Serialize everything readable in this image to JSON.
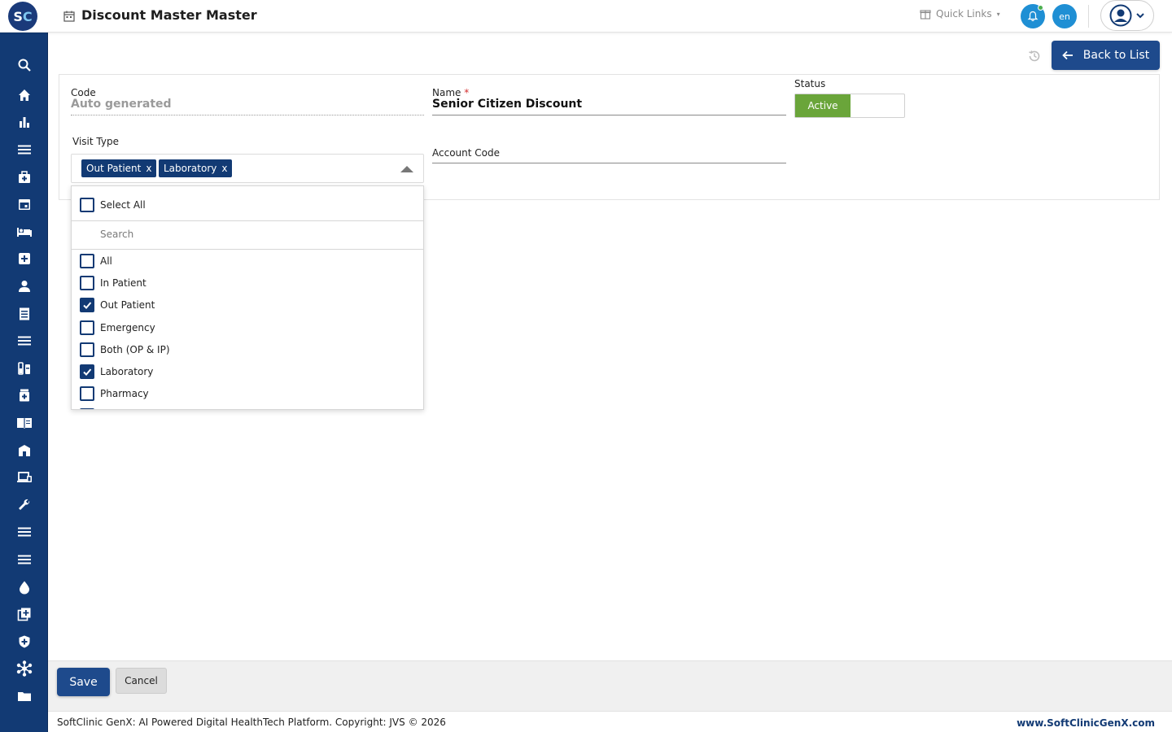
{
  "header": {
    "page_title": "Discount Master Master",
    "quick_links": "Quick Links",
    "language": "en"
  },
  "sidebar": {
    "icons": [
      "search-icon",
      "home-icon",
      "bar-chart-icon",
      "menu-icon",
      "medical-bag-icon",
      "calendar-icon",
      "bed-icon",
      "medical-cross-icon",
      "person-icon",
      "receipt-icon",
      "list-icon",
      "lab-icon",
      "medicine-icon",
      "book-icon",
      "building-icon",
      "devices-icon",
      "wrench-icon",
      "list-icon",
      "list-icon",
      "drop-icon",
      "add-document-icon",
      "shield-icon",
      "hub-icon",
      "folder-icon"
    ]
  },
  "toolbar": {
    "back_label": "Back to List"
  },
  "form": {
    "code_label": "Code",
    "code_value": "Auto generated",
    "name_label": "Name",
    "name_required": "*",
    "name_value": "Senior Citizen Discount",
    "status_label": "Status",
    "status_active": "Active",
    "visit_type_label": "Visit Type",
    "account_code_label": "Account Code",
    "visit_type_chips": [
      {
        "label": "Out Patient",
        "remove": "x"
      },
      {
        "label": "Laboratory",
        "remove": "x"
      }
    ]
  },
  "dropdown": {
    "select_all": "Select All",
    "search_placeholder": "Search",
    "options": [
      {
        "label": "All",
        "checked": false
      },
      {
        "label": "In Patient",
        "checked": false
      },
      {
        "label": "Out Patient",
        "checked": true
      },
      {
        "label": "Emergency",
        "checked": false
      },
      {
        "label": "Both (OP & IP)",
        "checked": false
      },
      {
        "label": "Laboratory",
        "checked": true
      },
      {
        "label": "Pharmacy",
        "checked": false
      }
    ]
  },
  "actions": {
    "save_label": "Save",
    "cancel_label": "Cancel"
  },
  "footer": {
    "copyright": "SoftClinic GenX: AI Powered Digital HealthTech Platform. Copyright: JVS © 2026",
    "website": "www.SoftClinicGenX.com"
  },
  "colors": {
    "primary": "#123a74",
    "button": "#1e4a8c",
    "active_green": "#6aa53a",
    "notify_blue": "#1f8fd4"
  }
}
